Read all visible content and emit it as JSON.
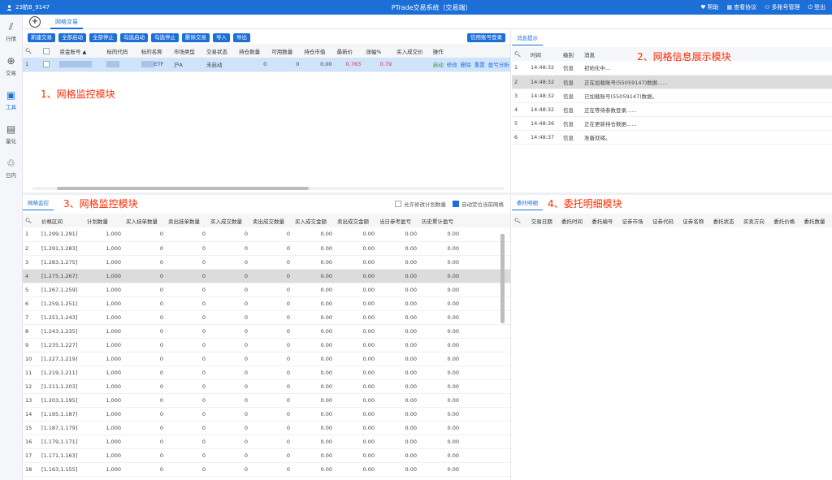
{
  "topbar": {
    "user": "23航B_9147",
    "title": "PTrade交易系统（交易端）",
    "actions": [
      "帮助",
      "查看协议",
      "多账号管理",
      "登出"
    ]
  },
  "nav": [
    {
      "label": "行情",
      "icon": "market-chart-icon",
      "glyph": "📈"
    },
    {
      "label": "交易",
      "icon": "trade-icon",
      "glyph": "⊕"
    },
    {
      "label": "工具",
      "icon": "toolbox-icon",
      "glyph": "▣",
      "active": true
    },
    {
      "label": "量化",
      "icon": "quant-icon",
      "glyph": "▤"
    },
    {
      "label": "日内",
      "icon": "intraday-icon",
      "glyph": "♲"
    }
  ],
  "tab": {
    "label": "网格交易"
  },
  "p1": {
    "buttons": [
      "新建交易",
      "全部启动",
      "全部停止",
      "勾选启动",
      "勾选停止",
      "删除交易",
      "导入",
      "导出"
    ],
    "right_button": "信用账号登录",
    "headers": [
      "",
      "",
      "资金账号 ▲",
      "标的代码",
      "标的名称",
      "市场类型",
      "交易状态",
      "持仓数量",
      "可用数量",
      "持仓市值",
      "最新价",
      "涨幅%",
      "买入成交价",
      "操作"
    ],
    "row": {
      "idx": "1",
      "name_suffix": "ETF",
      "market": "沪A",
      "status": "未启动",
      "hold": "0",
      "avail": "0",
      "mv": "0.00",
      "last": "0.763",
      "chg": "0.79",
      "ops": [
        "启动",
        "修改",
        "删除",
        "重置",
        "盈亏分析"
      ]
    },
    "annotation": "1、网格监控模块"
  },
  "p2": {
    "subtab": "消息提示",
    "headers": [
      "",
      "时间",
      "级别",
      "消息"
    ],
    "rows": [
      {
        "n": "1",
        "t": "14:48:32",
        "lv": "信息",
        "msg": "初始化中..."
      },
      {
        "n": "2",
        "t": "14:48:32",
        "lv": "信息",
        "msg": "正在加载账号(55059147)数据......"
      },
      {
        "n": "3",
        "t": "14:48:32",
        "lv": "信息",
        "msg": "已加载账号(55059147)数据。"
      },
      {
        "n": "4",
        "t": "14:48:32",
        "lv": "信息",
        "msg": "正在等待参数登录......"
      },
      {
        "n": "5",
        "t": "14:48:36",
        "lv": "信息",
        "msg": "正在更新持仓数据......"
      },
      {
        "n": "6",
        "t": "14:48:37",
        "lv": "信息",
        "msg": "准备就绪。"
      }
    ],
    "annotation": "2、网格信息展示模块"
  },
  "p3": {
    "subtab": "网格监控",
    "annotation": "3、网格监控模块",
    "opt1": "允许修改计划数量",
    "opt2": "自动定位当前网格",
    "headers": [
      "",
      "价格区间",
      "计划数量",
      "买入挂单数量",
      "卖出挂单数量",
      "买入成交数量",
      "卖出成交数量",
      "买入成交金额",
      "卖出成交金额",
      "当日参考盈亏",
      "历史累计盈亏"
    ],
    "rows": [
      {
        "n": "1",
        "r": "[1.299,1.291]"
      },
      {
        "n": "2",
        "r": "[1.291,1.283]"
      },
      {
        "n": "3",
        "r": "[1.283,1.275]"
      },
      {
        "n": "4",
        "r": "[1.275,1.267]"
      },
      {
        "n": "5",
        "r": "[1.267,1.259]"
      },
      {
        "n": "6",
        "r": "[1.259,1.251]"
      },
      {
        "n": "7",
        "r": "[1.251,1.243]"
      },
      {
        "n": "8",
        "r": "[1.243,1.235]"
      },
      {
        "n": "9",
        "r": "[1.235,1.227]"
      },
      {
        "n": "10",
        "r": "[1.227,1.219]"
      },
      {
        "n": "11",
        "r": "[1.219,1.211]"
      },
      {
        "n": "12",
        "r": "[1.211,1.203]"
      },
      {
        "n": "13",
        "r": "[1.203,1.195]"
      },
      {
        "n": "14",
        "r": "[1.195,1.187]"
      },
      {
        "n": "15",
        "r": "[1.187,1.179]"
      },
      {
        "n": "16",
        "r": "[1.179,1.171]"
      },
      {
        "n": "17",
        "r": "[1.171,1.163]"
      },
      {
        "n": "18",
        "r": "[1.163,1.155]"
      }
    ],
    "plan": "1,000",
    "zero": "0",
    "amt": "0.00"
  },
  "p4": {
    "subtab": "委托明细",
    "annotation": "4、委托明细模块",
    "headers": [
      "",
      "交易日期",
      "委托时间",
      "委托编号",
      "证券市场",
      "证券代码",
      "证券名称",
      "委托状态",
      "买卖方向",
      "委托价格",
      "委托数量"
    ]
  },
  "colors": {
    "accent": "#1d6fd8",
    "annotation": "#ff2a00",
    "selected_row": "#dcdcdc"
  }
}
